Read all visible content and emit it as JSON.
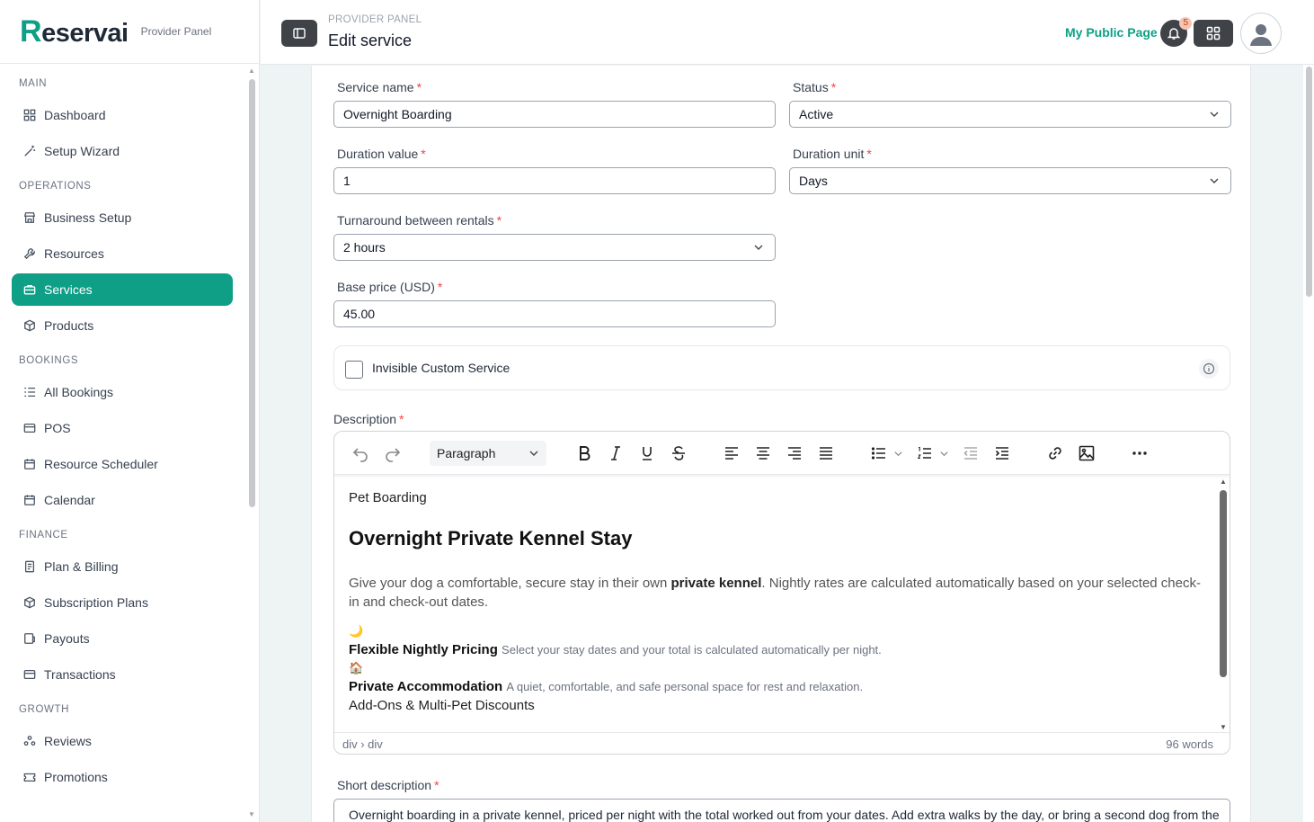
{
  "brand": {
    "logo_initial": "R",
    "logo_rest": "eservai",
    "subtitle": "Provider Panel"
  },
  "sidebar": {
    "sections": [
      {
        "title": "MAIN",
        "items": [
          {
            "label": "Dashboard",
            "icon": "grid-icon"
          },
          {
            "label": "Setup Wizard",
            "icon": "wand-icon"
          }
        ]
      },
      {
        "title": "OPERATIONS",
        "items": [
          {
            "label": "Business Setup",
            "icon": "store-icon"
          },
          {
            "label": "Resources",
            "icon": "wrench-icon"
          },
          {
            "label": "Services",
            "icon": "briefcase-icon",
            "active": true
          },
          {
            "label": "Products",
            "icon": "box-icon"
          }
        ]
      },
      {
        "title": "BOOKINGS",
        "items": [
          {
            "label": "All Bookings",
            "icon": "list-icon"
          },
          {
            "label": "POS",
            "icon": "card-icon"
          },
          {
            "label": "Resource Scheduler",
            "icon": "calendar-icon"
          },
          {
            "label": "Calendar",
            "icon": "calendar-icon"
          }
        ]
      },
      {
        "title": "FINANCE",
        "items": [
          {
            "label": "Plan & Billing",
            "icon": "file-icon"
          },
          {
            "label": "Subscription Plans",
            "icon": "box-icon"
          },
          {
            "label": "Payouts",
            "icon": "wallet-icon"
          },
          {
            "label": "Transactions",
            "icon": "card-icon"
          }
        ]
      },
      {
        "title": "GROWTH",
        "items": [
          {
            "label": "Reviews",
            "icon": "users-icon"
          },
          {
            "label": "Promotions",
            "icon": "ticket-icon"
          }
        ]
      }
    ]
  },
  "header": {
    "breadcrumb": "PROVIDER PANEL",
    "title": "Edit service",
    "public_link": "My Public Page",
    "notification_count": "5"
  },
  "form": {
    "service_name": {
      "label": "Service name",
      "value": "Overnight Boarding"
    },
    "status": {
      "label": "Status",
      "value": "Active"
    },
    "duration_value": {
      "label": "Duration value",
      "value": "1"
    },
    "duration_unit": {
      "label": "Duration unit",
      "value": "Days"
    },
    "turnaround": {
      "label": "Turnaround between rentals",
      "value": "2 hours"
    },
    "base_price": {
      "label": "Base price (USD)",
      "value": "45.00"
    },
    "invisible": {
      "label": "Invisible Custom Service"
    },
    "description": {
      "label": "Description",
      "format": "Paragraph",
      "kicker": "Pet Boarding",
      "heading": "Overnight Private Kennel Stay",
      "intro_pre": "Give your dog a comfortable, secure stay in their own ",
      "intro_bold": "private kennel",
      "intro_post": ". Nightly rates are calculated automatically based on your selected check-in and check-out dates.",
      "emoji1": "🌙",
      "feature1_title": "Flexible Nightly Pricing",
      "feature1_text": "Select your stay dates and your total is calculated automatically per night.",
      "emoji2": "🏠",
      "feature2_title": "Private Accommodation",
      "feature2_text": "A quiet, comfortable, and safe personal space for rest and relaxation.",
      "addons": "Add-Ons & Multi-Pet Discounts",
      "path": "div › div",
      "word_count": "96 words"
    },
    "short_description": {
      "label": "Short description",
      "value": "Overnight boarding in a private kennel, priced per night with the total worked out from your dates. Add extra walks by the day, or bring a second dog from the"
    }
  },
  "colors": {
    "accent": "#0e9f86",
    "dark_button": "#3f4347",
    "required": "#ef4444"
  }
}
